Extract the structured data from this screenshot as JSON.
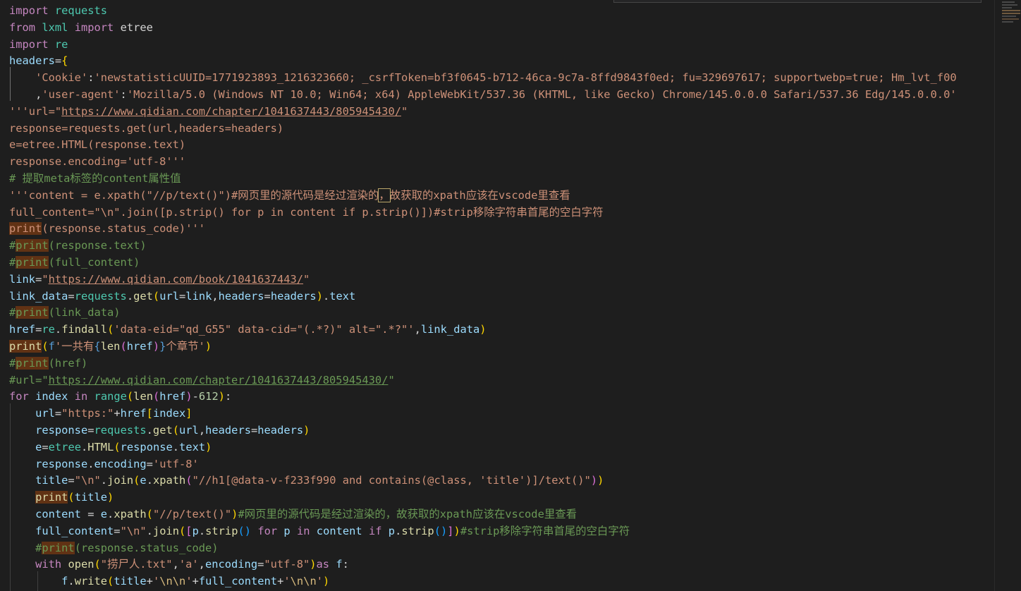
{
  "editor": {
    "lines": [
      [
        [
          "import",
          "t-kw"
        ],
        [
          " ",
          ""
        ],
        [
          "requests",
          "t-cls"
        ]
      ],
      [
        [
          "from",
          "t-kw"
        ],
        [
          " ",
          ""
        ],
        [
          "lxml",
          "t-cls"
        ],
        [
          " ",
          ""
        ],
        [
          "import",
          "t-kw"
        ],
        [
          " etree",
          ""
        ]
      ],
      [
        [
          "import",
          "t-kw"
        ],
        [
          " ",
          ""
        ],
        [
          "re",
          "t-cls"
        ]
      ],
      [
        [
          "headers",
          "t-var"
        ],
        [
          "=",
          ""
        ],
        [
          "{",
          "t-b1"
        ]
      ],
      [
        [
          "    ",
          ""
        ],
        [
          "'Cookie'",
          "t-str"
        ],
        [
          ":",
          ""
        ],
        [
          "'newstatisticUUID=1771923893_1216323660; _csrfToken=bf3f0645-b712-46ca-9c7a-8ffd9843f0ed; fu=329697617; supportwebp=true; Hm_lvt_f00",
          "t-str"
        ]
      ],
      [
        [
          "    ,",
          ""
        ],
        [
          "'user-agent'",
          "t-str"
        ],
        [
          ":",
          ""
        ],
        [
          "'Mozilla/5.0 (Windows NT 10.0; Win64; x64) AppleWebKit/537.36 (KHTML, like Gecko) Chrome/145.0.0.0 Safari/537.36 Edg/145.0.0.0'",
          "t-str"
        ]
      ],
      [
        [
          "'''url=\"",
          "t-str"
        ],
        [
          "https://www.qidian.com/chapter/1041637443/805945430/",
          "t-str t-url"
        ],
        [
          "\"",
          "t-str"
        ]
      ],
      [
        [
          "response=requests.get(url,headers=headers)",
          "t-str"
        ]
      ],
      [
        [
          "e=etree.HTML(response.text)",
          "t-str"
        ]
      ],
      [
        [
          "response.encoding='utf-8'''",
          "t-str"
        ]
      ],
      [
        [
          "# 提取meta标签的content属性值",
          "t-com"
        ]
      ],
      [
        [
          "'''content = e.xpath(\"//p/text()\")#网页里的源代码是经过渲染的",
          "t-str"
        ],
        [
          "，",
          "t-str t-box"
        ],
        [
          "故获取的xpath应该在vscode里查看",
          "t-str"
        ]
      ],
      [
        [
          "full_content=\"\\n\".join([p.strip() for p in content if p.strip()])#strip移除字符串首尾的空白字符",
          "t-str"
        ]
      ],
      [
        [
          "print",
          "t-str t-hl"
        ],
        [
          "(response.status_code)'''",
          "t-str"
        ]
      ],
      [
        [
          "#",
          "t-com"
        ],
        [
          "print",
          "t-com t-hl"
        ],
        [
          "(response.text)",
          "t-com"
        ]
      ],
      [
        [
          "#",
          "t-com"
        ],
        [
          "print",
          "t-com t-hl"
        ],
        [
          "(full_content)",
          "t-com"
        ]
      ],
      [
        [
          "link",
          "t-var"
        ],
        [
          "=",
          ""
        ],
        [
          "\"",
          "t-str"
        ],
        [
          "https://www.qidian.com/book/1041637443/",
          "t-str t-url"
        ],
        [
          "\"",
          "t-str"
        ]
      ],
      [
        [
          "link_data",
          "t-var"
        ],
        [
          "=",
          ""
        ],
        [
          "requests",
          "t-cls"
        ],
        [
          ".",
          ""
        ],
        [
          "get",
          "t-fn"
        ],
        [
          "(",
          "t-b1"
        ],
        [
          "url",
          "t-var"
        ],
        [
          "=",
          ""
        ],
        [
          "link",
          "t-var"
        ],
        [
          ",",
          ""
        ],
        [
          "headers",
          "t-var"
        ],
        [
          "=",
          ""
        ],
        [
          "headers",
          "t-var"
        ],
        [
          ")",
          "t-b1"
        ],
        [
          ".",
          ""
        ],
        [
          "text",
          "t-var"
        ]
      ],
      [
        [
          "#",
          "t-com"
        ],
        [
          "print",
          "t-com t-hl"
        ],
        [
          "(link_data)",
          "t-com"
        ]
      ],
      [
        [
          "href",
          "t-var"
        ],
        [
          "=",
          ""
        ],
        [
          "re",
          "t-cls"
        ],
        [
          ".",
          ""
        ],
        [
          "findall",
          "t-fn"
        ],
        [
          "(",
          "t-b1"
        ],
        [
          "'data-eid=\"qd_G55\" data-cid=\"(.*?)\" alt=\".*?\"'",
          "t-str"
        ],
        [
          ",",
          ""
        ],
        [
          "link_data",
          "t-var"
        ],
        [
          ")",
          "t-b1"
        ]
      ],
      [
        [
          "print",
          "t-fn t-hl"
        ],
        [
          "(",
          "t-b1"
        ],
        [
          "f",
          "t-bl"
        ],
        [
          "'一共有",
          "t-str"
        ],
        [
          "{",
          "t-bl"
        ],
        [
          "len",
          "t-fn"
        ],
        [
          "(",
          "t-b2"
        ],
        [
          "href",
          "t-var"
        ],
        [
          ")",
          "t-b2"
        ],
        [
          "}",
          "t-bl"
        ],
        [
          "个章节'",
          "t-str"
        ],
        [
          ")",
          "t-b1"
        ]
      ],
      [
        [
          "#",
          "t-com"
        ],
        [
          "print",
          "t-com t-hl"
        ],
        [
          "(href)",
          "t-com"
        ]
      ],
      [
        [
          "#url=\"",
          "t-com"
        ],
        [
          "https://www.qidian.com/chapter/1041637443/805945430/",
          "t-com t-url"
        ],
        [
          "\"",
          "t-com"
        ]
      ],
      [
        [
          "for",
          "t-kw"
        ],
        [
          " ",
          ""
        ],
        [
          "index",
          "t-var"
        ],
        [
          " ",
          ""
        ],
        [
          "in",
          "t-kw"
        ],
        [
          " ",
          ""
        ],
        [
          "range",
          "t-cls"
        ],
        [
          "(",
          "t-b1"
        ],
        [
          "len",
          "t-fn"
        ],
        [
          "(",
          "t-b2"
        ],
        [
          "href",
          "t-var"
        ],
        [
          ")",
          "t-b2"
        ],
        [
          "-",
          ""
        ],
        [
          "612",
          "t-num"
        ],
        [
          ")",
          "t-b1"
        ],
        [
          ":",
          ""
        ]
      ],
      [
        [
          "    ",
          ""
        ],
        [
          "url",
          "t-var"
        ],
        [
          "=",
          ""
        ],
        [
          "\"https:\"",
          "t-str"
        ],
        [
          "+",
          ""
        ],
        [
          "href",
          "t-var"
        ],
        [
          "[",
          "t-b1"
        ],
        [
          "index",
          "t-var"
        ],
        [
          "]",
          "t-b1"
        ]
      ],
      [
        [
          "    ",
          ""
        ],
        [
          "response",
          "t-var"
        ],
        [
          "=",
          ""
        ],
        [
          "requests",
          "t-cls"
        ],
        [
          ".",
          ""
        ],
        [
          "get",
          "t-fn"
        ],
        [
          "(",
          "t-b1"
        ],
        [
          "url",
          "t-var"
        ],
        [
          ",",
          ""
        ],
        [
          "headers",
          "t-var"
        ],
        [
          "=",
          ""
        ],
        [
          "headers",
          "t-var"
        ],
        [
          ")",
          "t-b1"
        ]
      ],
      [
        [
          "    ",
          ""
        ],
        [
          "e",
          "t-var"
        ],
        [
          "=",
          ""
        ],
        [
          "etree",
          "t-cls"
        ],
        [
          ".",
          ""
        ],
        [
          "HTML",
          "t-fn"
        ],
        [
          "(",
          "t-b1"
        ],
        [
          "response",
          "t-var"
        ],
        [
          ".",
          ""
        ],
        [
          "text",
          "t-var"
        ],
        [
          ")",
          "t-b1"
        ]
      ],
      [
        [
          "    ",
          ""
        ],
        [
          "response",
          "t-var"
        ],
        [
          ".",
          ""
        ],
        [
          "encoding",
          "t-var"
        ],
        [
          "=",
          ""
        ],
        [
          "'utf-8'",
          "t-str"
        ]
      ],
      [
        [
          "    ",
          ""
        ],
        [
          "title",
          "t-var"
        ],
        [
          "=",
          ""
        ],
        [
          "\"\\n\"",
          "t-str"
        ],
        [
          ".",
          ""
        ],
        [
          "join",
          "t-fn"
        ],
        [
          "(",
          "t-b1"
        ],
        [
          "e",
          "t-var"
        ],
        [
          ".",
          ""
        ],
        [
          "xpath",
          "t-fn"
        ],
        [
          "(",
          "t-b2"
        ],
        [
          "\"//h1[@data-v-f233f990 and contains(@class, 'title')]/text()\"",
          "t-str"
        ],
        [
          ")",
          "t-b2"
        ],
        [
          ")",
          "t-b1"
        ]
      ],
      [
        [
          "    ",
          ""
        ],
        [
          "print",
          "t-fn t-hl"
        ],
        [
          "(",
          "t-b1"
        ],
        [
          "title",
          "t-var"
        ],
        [
          ")",
          "t-b1"
        ]
      ],
      [
        [
          "    ",
          ""
        ],
        [
          "content",
          "t-var"
        ],
        [
          " = ",
          ""
        ],
        [
          "e",
          "t-var"
        ],
        [
          ".",
          ""
        ],
        [
          "xpath",
          "t-fn"
        ],
        [
          "(",
          "t-b1"
        ],
        [
          "\"//p/text()\"",
          "t-str"
        ],
        [
          ")",
          "t-b1"
        ],
        [
          "#网页里的源代码是经过渲染的，故获取的xpath应该在vscode里查看",
          "t-com"
        ]
      ],
      [
        [
          "    ",
          ""
        ],
        [
          "full_content",
          "t-var"
        ],
        [
          "=",
          ""
        ],
        [
          "\"\\n\"",
          "t-str"
        ],
        [
          ".",
          ""
        ],
        [
          "join",
          "t-fn"
        ],
        [
          "(",
          "t-b1"
        ],
        [
          "[",
          "t-b2"
        ],
        [
          "p",
          "t-var"
        ],
        [
          ".",
          ""
        ],
        [
          "strip",
          "t-fn"
        ],
        [
          "(",
          "t-b3"
        ],
        [
          ")",
          "t-b3"
        ],
        [
          " ",
          ""
        ],
        [
          "for",
          "t-kw"
        ],
        [
          " ",
          ""
        ],
        [
          "p",
          "t-var"
        ],
        [
          " ",
          ""
        ],
        [
          "in",
          "t-kw"
        ],
        [
          " ",
          ""
        ],
        [
          "content",
          "t-var"
        ],
        [
          " ",
          ""
        ],
        [
          "if",
          "t-kw"
        ],
        [
          " ",
          ""
        ],
        [
          "p",
          "t-var"
        ],
        [
          ".",
          ""
        ],
        [
          "strip",
          "t-fn"
        ],
        [
          "(",
          "t-b3"
        ],
        [
          ")",
          "t-b3"
        ],
        [
          "]",
          "t-b2"
        ],
        [
          ")",
          "t-b1"
        ],
        [
          "#strip移除字符串首尾的空白字符",
          "t-com"
        ]
      ],
      [
        [
          "    ",
          ""
        ],
        [
          "#",
          "t-com"
        ],
        [
          "print",
          "t-com t-hl"
        ],
        [
          "(response.status_code)",
          "t-com"
        ]
      ],
      [
        [
          "    ",
          ""
        ],
        [
          "with",
          "t-kw"
        ],
        [
          " ",
          ""
        ],
        [
          "open",
          "t-fn"
        ],
        [
          "(",
          "t-b1"
        ],
        [
          "\"捞尸人.txt\"",
          "t-str"
        ],
        [
          ",",
          ""
        ],
        [
          "'a'",
          "t-str"
        ],
        [
          ",",
          ""
        ],
        [
          "encoding",
          "t-var"
        ],
        [
          "=",
          ""
        ],
        [
          "\"utf-8\"",
          "t-str"
        ],
        [
          ")",
          "t-b1"
        ],
        [
          "as",
          "t-kw"
        ],
        [
          " ",
          ""
        ],
        [
          "f",
          "t-var"
        ],
        [
          ":",
          ""
        ]
      ],
      [
        [
          "        ",
          ""
        ],
        [
          "f",
          "t-var"
        ],
        [
          ".",
          ""
        ],
        [
          "write",
          "t-fn"
        ],
        [
          "(",
          "t-b1"
        ],
        [
          "title",
          "t-var"
        ],
        [
          "+",
          ""
        ],
        [
          "'",
          "t-str"
        ],
        [
          "\\n\\n",
          "t-esc"
        ],
        [
          "'",
          "t-str"
        ],
        [
          "+",
          ""
        ],
        [
          "full_content",
          "t-var"
        ],
        [
          "+",
          ""
        ],
        [
          "'",
          "t-str"
        ],
        [
          "\\n\\n",
          "t-esc"
        ],
        [
          "'",
          "t-str"
        ],
        [
          ")",
          "t-b1"
        ]
      ]
    ]
  }
}
